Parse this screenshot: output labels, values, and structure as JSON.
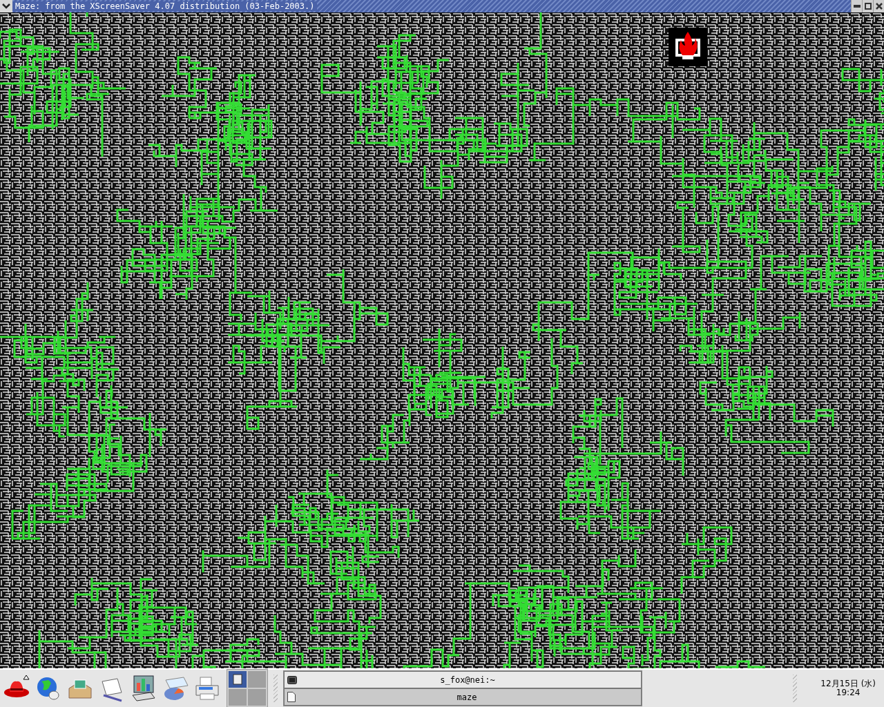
{
  "window": {
    "title": "Maze: from the XScreenSaver 4.07 distribution (03-Feb-2003.)"
  },
  "pager": {
    "desktops": [
      {
        "selected": true
      },
      {
        "selected": false
      },
      {
        "selected": false
      },
      {
        "selected": false
      }
    ]
  },
  "tasks": [
    {
      "label": "s_fox@nei:~",
      "kind": "terminal",
      "selected": false
    },
    {
      "label": "maze",
      "kind": "window",
      "selected": true
    }
  ],
  "clock": {
    "date": "12月15日 (水)",
    "time": "19:24"
  }
}
